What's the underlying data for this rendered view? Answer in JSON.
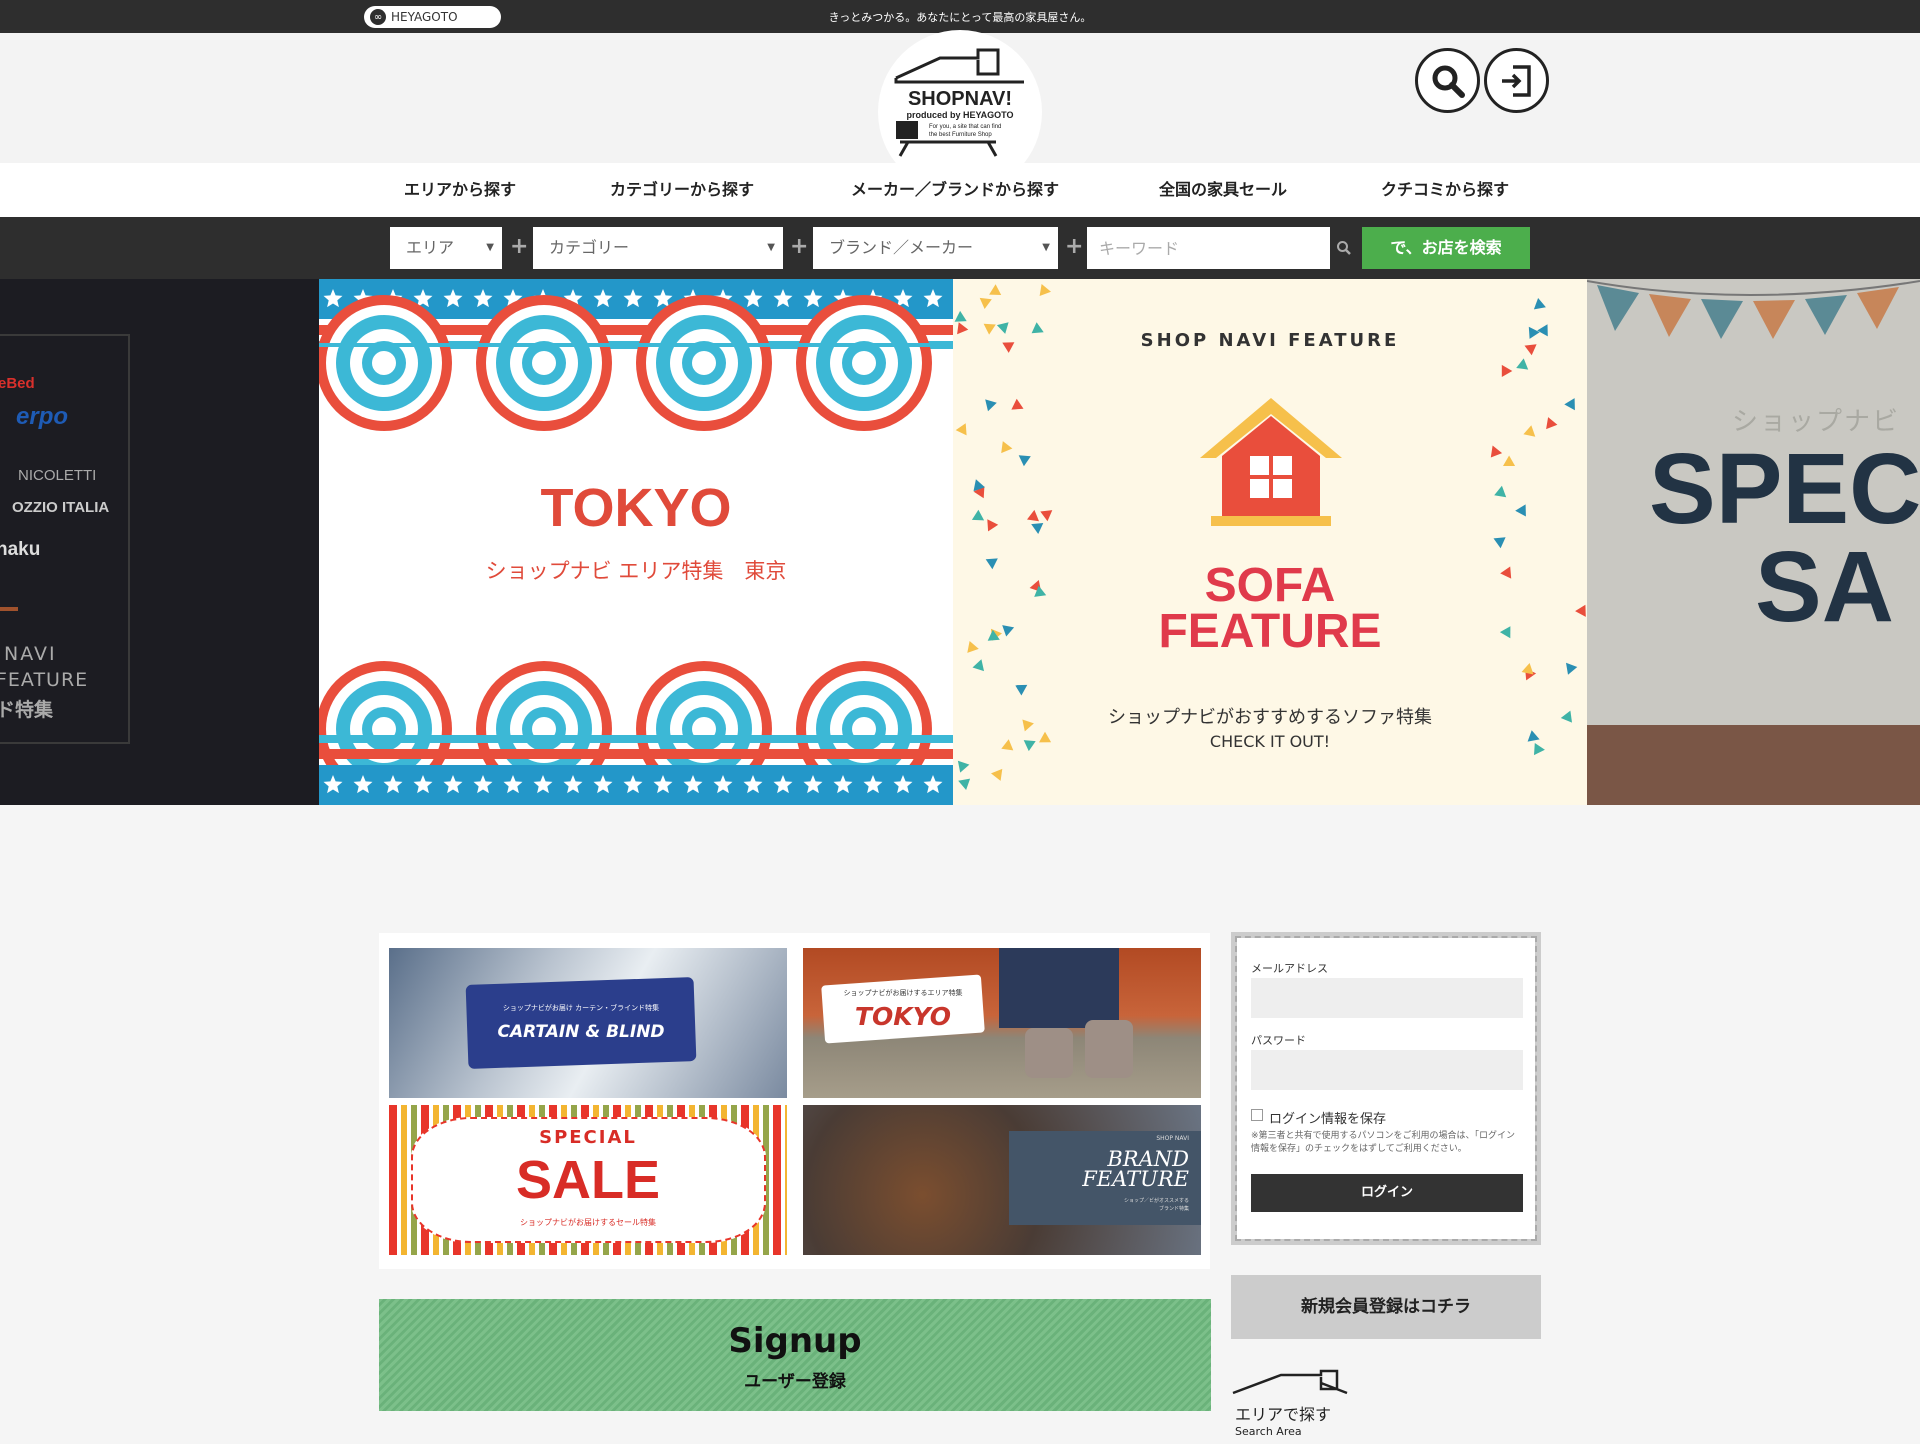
{
  "topbar": {
    "brand": "HEYAGOTO",
    "tagline": "きっとみつかる。あなたにとって最高の家具屋さん。"
  },
  "logo": {
    "name": "SHOPNAV!",
    "sub": "produced by HEYAGOTO",
    "desc1": "For you, a site that can find",
    "desc2": "the best Furniture Shop"
  },
  "nav": {
    "items": [
      "エリアから探す",
      "カテゴリーから探す",
      "メーカー／ブランドから探す",
      "全国の家具セール",
      "クチコミから探す"
    ]
  },
  "search": {
    "area": "エリア",
    "category": "カテゴリー",
    "brand": "ブランド／メーカー",
    "keyword_placeholder": "キーワード",
    "button": "で、お店を検索"
  },
  "slider": {
    "left": {
      "brands": [
        "eBed",
        "erpo",
        "NICOLETTI",
        "OZZIO ITALIA",
        "naku"
      ],
      "line1": "NAVI",
      "line2": "FEATURE",
      "line3": "ド特集"
    },
    "tokyo": {
      "title": "TOKYO",
      "subtitle": "ショップナビ エリア特集　東京"
    },
    "sofa": {
      "eyebrow": "SHOP NAVI FEATURE",
      "line1": "SOFA",
      "line2": "FEATURE",
      "sub1": "ショップナビがおすすめするソファ特集",
      "sub2": "CHECK IT OUT!"
    },
    "right": {
      "kana": "ショップナビ",
      "l1": "SPEC",
      "l2": "SA"
    }
  },
  "banners": {
    "curtain": {
      "small": "ショップナビがお届け カーテン・ブラインド特集",
      "title": "CARTAIN & BLIND"
    },
    "tokyo": {
      "small": "ショップナビがお届けするエリア特集",
      "title": "TOKYO"
    },
    "sale": {
      "l1": "SPECIAL",
      "l2": "SALE",
      "small": "ショップナビがお届けするセール特集"
    },
    "brand": {
      "eyebrow": "SHOP NAVI",
      "l1": "BRAND",
      "l2": "FEATURE",
      "small1": "ショップ／ビがオススメする",
      "small2": "ブランド特集"
    }
  },
  "signup": {
    "title": "Signup",
    "sub": "ユーザー登録"
  },
  "login": {
    "email_label": "メールアドレス",
    "password_label": "パスワード",
    "remember": "ログイン情報を保存",
    "note": "※第三者と共有で使用するパソコンをご利用の場合は、「ログイン情報を保存」のチェックをはずしてご利用ください。",
    "button": "ログイン"
  },
  "register": {
    "label": "新規会員登録はコチラ"
  },
  "area": {
    "title": "エリアで探す",
    "sub": "Search Area"
  }
}
